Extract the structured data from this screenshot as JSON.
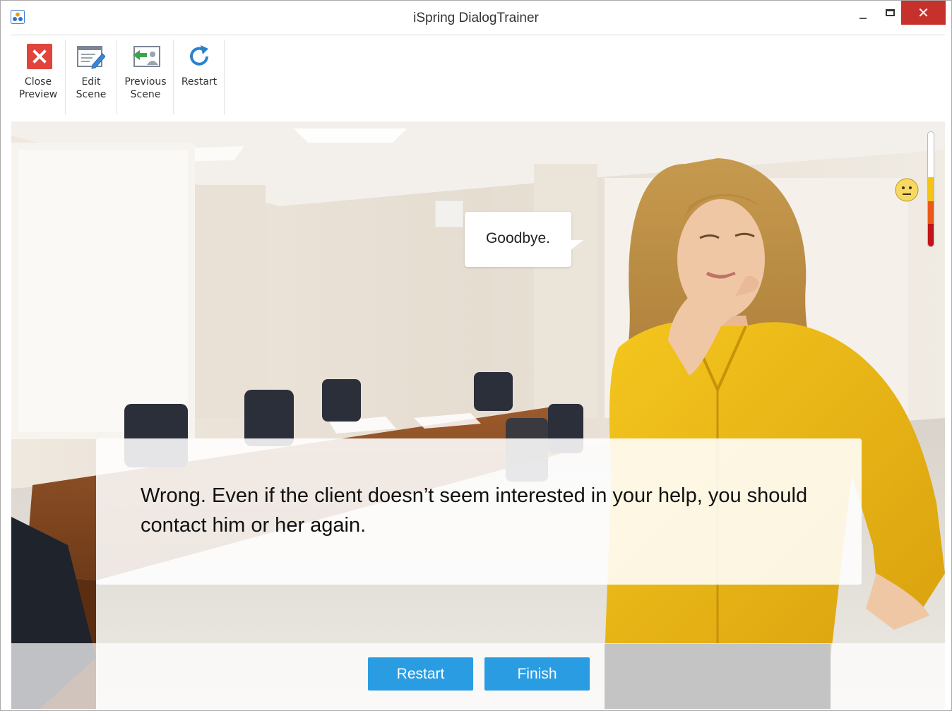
{
  "window": {
    "title": "iSpring DialogTrainer",
    "controls": {
      "minimize": "minimize-icon",
      "maximize": "maximize-icon",
      "close": "close-icon",
      "close_glyph": "✕"
    }
  },
  "toolbar": {
    "items": [
      {
        "label": "Close\nPreview",
        "icon": "close-preview-icon"
      },
      {
        "label": "Edit\nScene",
        "icon": "edit-scene-icon"
      },
      {
        "label": "Previous\nScene",
        "icon": "previous-scene-icon"
      },
      {
        "label": "Restart",
        "icon": "restart-icon"
      }
    ]
  },
  "scene": {
    "character_speech": "Goodbye.",
    "feedback": "Wrong. Even if the client doesn’t seem interested in your help, you should contact him or her again.",
    "mood": {
      "icon": "neutral-face-icon",
      "level": 0.5
    },
    "meter_colors": {
      "yellow": "#f3c318",
      "orange": "#e8591a",
      "red": "#c0141a"
    }
  },
  "footer": {
    "restart_label": "Restart",
    "finish_label": "Finish"
  },
  "colors": {
    "accent_button": "#2a9de2",
    "close_button": "#c7312b"
  }
}
